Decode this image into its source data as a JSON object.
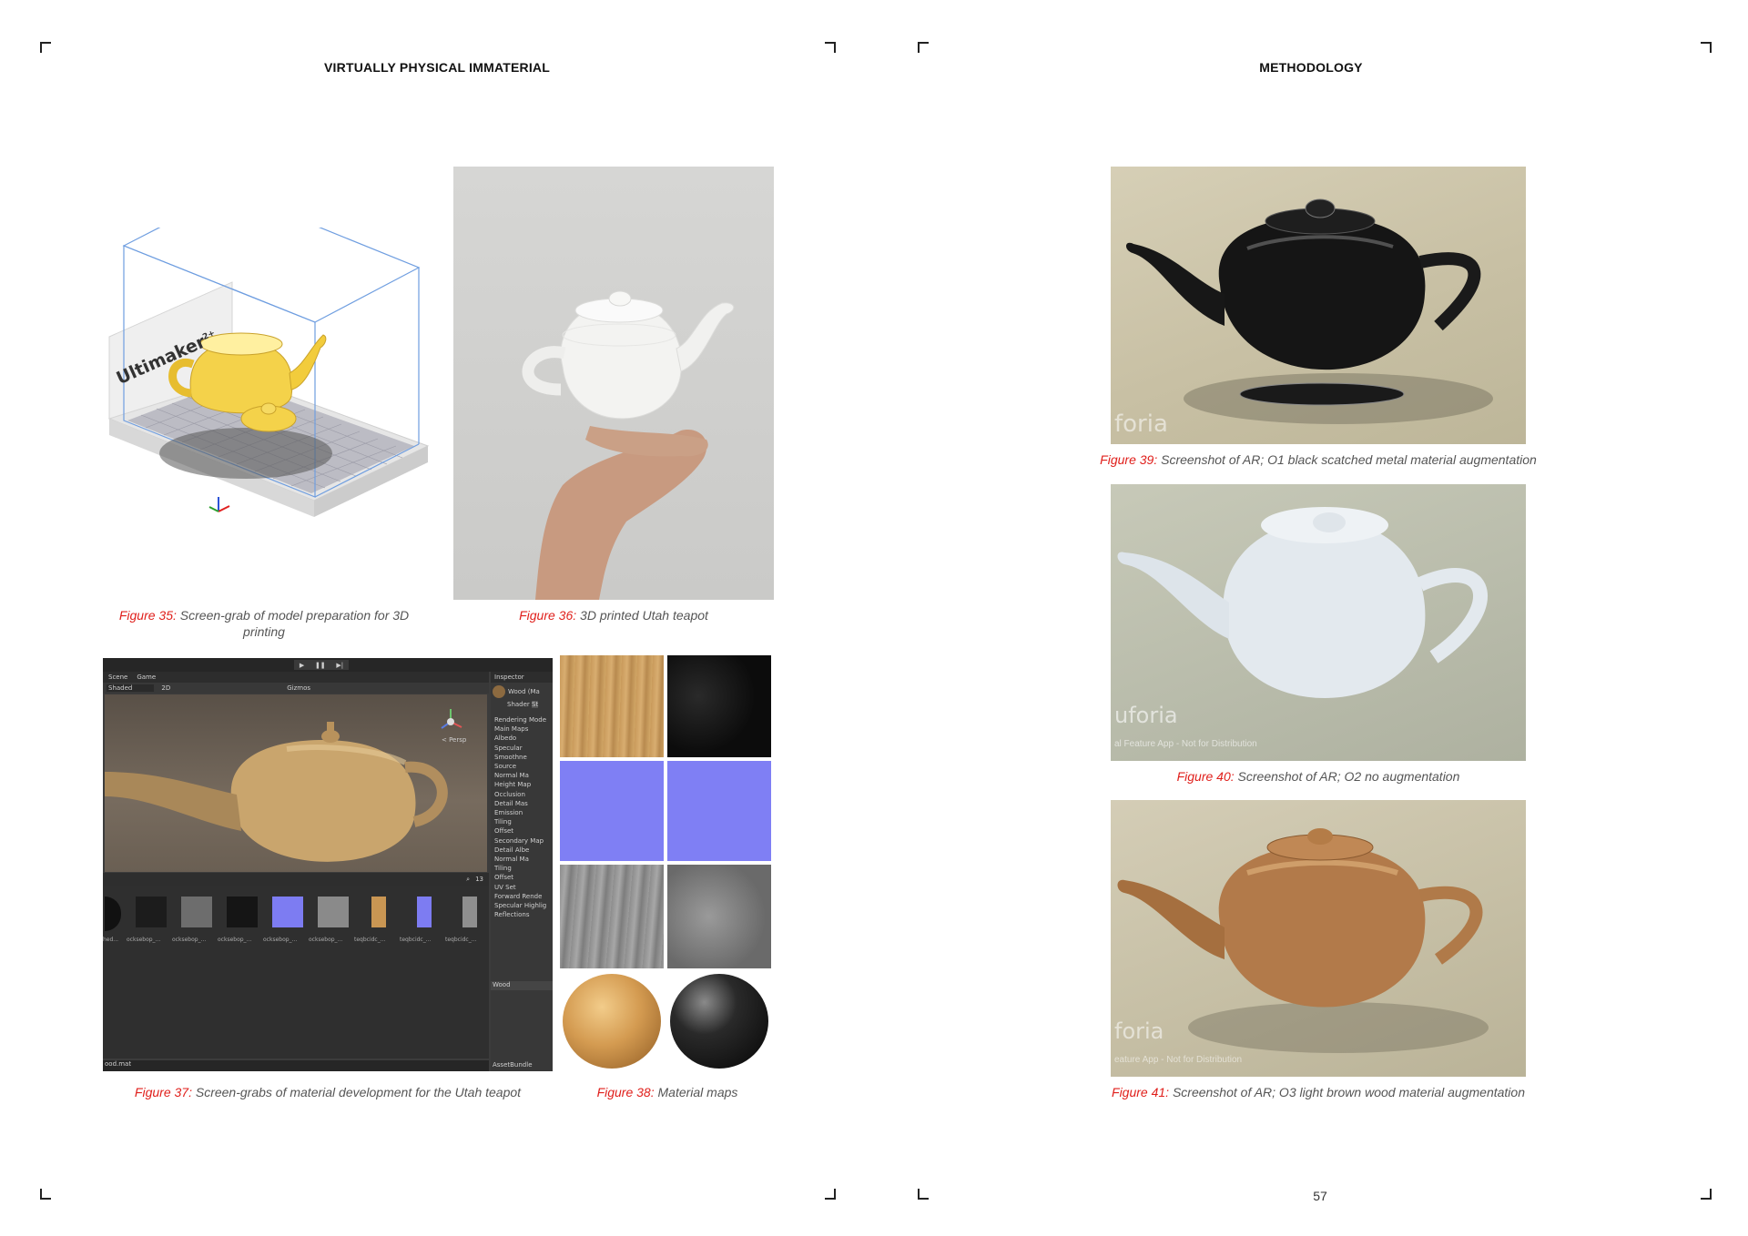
{
  "left_page": {
    "running_head": "VIRTUALLY PHYSICAL IMMATERIAL",
    "figures": [
      {
        "num": "Figure 35:",
        "text": "Screen-grab of model preparation for 3D printing",
        "brand": "Ultimaker",
        "brand_sup": "2+"
      },
      {
        "num": "Figure 36:",
        "text": "3D printed Utah teapot"
      },
      {
        "num": "Figure 37:",
        "text": "Screen-grabs of material development for the Utah teapot"
      },
      {
        "num": "Figure 38:",
        "text": "Material maps"
      }
    ],
    "unity": {
      "tabs": [
        "Scene",
        "Game"
      ],
      "shading": "Shaded",
      "mode": "2D",
      "gizmos": "Gizmos",
      "persp": "< Persp",
      "inspector_tab": "Inspector",
      "material_name": "Wood (Ma",
      "shader_label": "Shader",
      "shader_value": "St",
      "inspector_rows": [
        "Rendering Mode",
        "Main Maps",
        "Albedo",
        "Specular",
        "Smoothne",
        "Source",
        "Normal Ma",
        "Height Map",
        "Occlusion",
        "Detail Mas",
        "Emission",
        "Tiling",
        "Offset",
        "Secondary Map",
        "Detail Albe",
        "Normal Ma",
        "Tiling",
        "Offset",
        "UV Set",
        "Forward Rende",
        "Specular Highlig",
        "Reflections"
      ],
      "footer_label": "Wood",
      "assetbundle": "AssetBundle",
      "asset_labels": [
        "hed...",
        "ocksebop_...",
        "ocksebop_...",
        "ocksebop_...",
        "ocksebop_...",
        "ocksebop_...",
        "teqbcidc_...",
        "teqbcidc_...",
        "teqbcidc_..."
      ],
      "file": "ood.mat",
      "count": "13"
    }
  },
  "right_page": {
    "running_head": "METHODOLOGY",
    "page_number": "57",
    "figures": [
      {
        "num": "Figure 39:",
        "text": "Screenshot of AR; O1 black scatched metal material augmentation",
        "watermark": "foria"
      },
      {
        "num": "Figure 40:",
        "text": "Screenshot of AR; O2 no augmentation",
        "watermark": "uforia",
        "watermark_sub": "al Feature App - Not for Distribution"
      },
      {
        "num": "Figure 41:",
        "text": "Screenshot of AR; O3 light brown wood material augmentation",
        "watermark": "foria",
        "watermark_sub": "eature App - Not for Distribution"
      }
    ]
  },
  "colors": {
    "figure_label": "#e0201c",
    "caption_text": "#555555"
  }
}
